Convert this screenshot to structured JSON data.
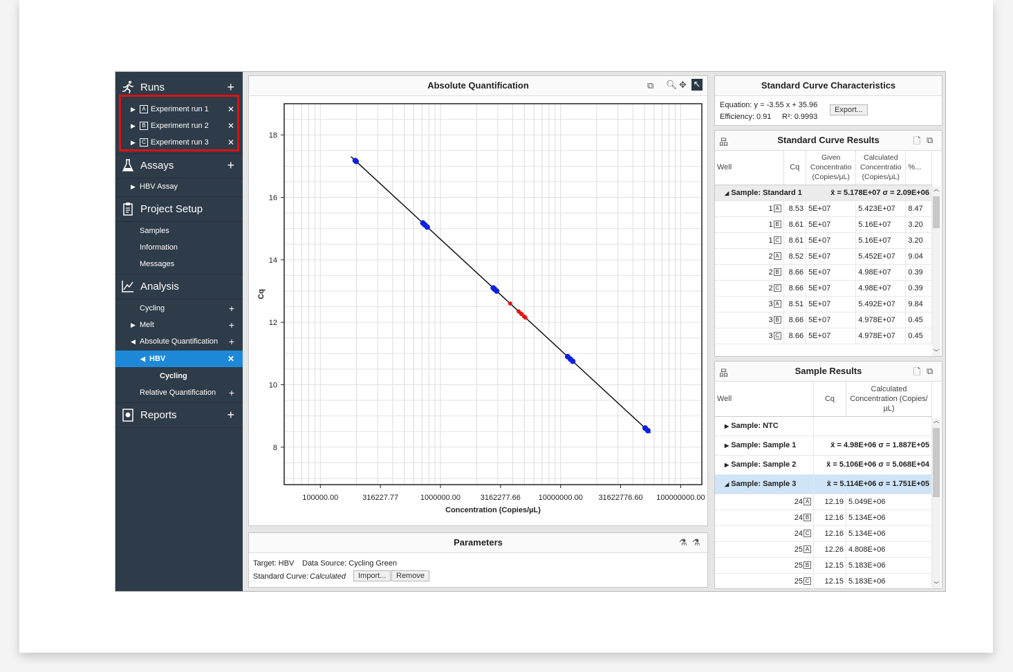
{
  "sidebar": {
    "runs": {
      "label": "Runs",
      "items": [
        {
          "letter": "A",
          "label": "Experiment run 1"
        },
        {
          "letter": "B",
          "label": "Experiment run 2"
        },
        {
          "letter": "C",
          "label": "Experiment run 3"
        }
      ]
    },
    "assays": {
      "label": "Assays",
      "items": [
        {
          "label": "HBV Assay"
        }
      ]
    },
    "project": {
      "label": "Project Setup",
      "items": [
        {
          "label": "Samples"
        },
        {
          "label": "Information"
        },
        {
          "label": "Messages"
        }
      ]
    },
    "analysis": {
      "label": "Analysis",
      "items": [
        {
          "label": "Cycling"
        },
        {
          "label": "Melt"
        },
        {
          "label": "Absolute Quantification"
        },
        {
          "label": "HBV"
        },
        {
          "label": "Cycling"
        },
        {
          "label": "Relative Quantification"
        }
      ]
    },
    "reports": {
      "label": "Reports"
    }
  },
  "chart_panel": {
    "title": "Absolute Quantification"
  },
  "chart_data": {
    "type": "scatter",
    "xlabel": "Concentration (Copies/µL)",
    "ylabel": "Cq",
    "x_scale": "log",
    "xlim": [
      50000,
      150000000
    ],
    "ylim": [
      6.8,
      19
    ],
    "x_ticks": [
      100000,
      316227.77,
      1000000,
      3162277.66,
      10000000,
      31622776.6,
      100000000
    ],
    "x_tick_labels": [
      "100000.00",
      "316227.77",
      "1000000.00",
      "3162277.66",
      "10000000.00",
      "31622776.60",
      "100000000.00"
    ],
    "y_ticks": [
      8,
      10,
      12,
      14,
      16,
      18
    ],
    "y_tick_labels": [
      "8",
      "10",
      "12",
      "14",
      "16",
      "18"
    ],
    "fit_line": {
      "slope": -3.55,
      "intercept": 35.96,
      "x_range": [
        180000,
        56000000
      ]
    },
    "series": [
      {
        "color": "#1020e0",
        "points": [
          {
            "x": 50000000,
            "y": 8.53
          },
          {
            "x": 50000000,
            "y": 8.61
          },
          {
            "x": 50000000,
            "y": 8.61
          },
          {
            "x": 5000000,
            "y": 10.75
          },
          {
            "x": 5000000,
            "y": 10.82
          },
          {
            "x": 5000000,
            "y": 10.9
          },
          {
            "x": 500000,
            "y": 13.0
          },
          {
            "x": 500000,
            "y": 13.06
          },
          {
            "x": 500000,
            "y": 13.1
          },
          {
            "x": 50000,
            "y": 15.05
          },
          {
            "x": 50000,
            "y": 15.12
          },
          {
            "x": 50000,
            "y": 15.18
          },
          {
            "x": 5000,
            "y": 17.15
          },
          {
            "x": 5000,
            "y": 17.18
          }
        ]
      },
      {
        "color": "#e01818",
        "points": [
          {
            "x": 4980000,
            "y": 12.6
          },
          {
            "x": 5106000,
            "y": 12.35
          },
          {
            "x": 5114000,
            "y": 12.28
          },
          {
            "x": 5049000,
            "y": 12.19
          },
          {
            "x": 5134000,
            "y": 12.16
          },
          {
            "x": 4808000,
            "y": 12.26
          },
          {
            "x": 5183000,
            "y": 12.15
          }
        ]
      }
    ]
  },
  "params": {
    "title": "Parameters",
    "target": "Target: HBV",
    "source": "Data Source: Cycling Green",
    "curve_label": "Standard Curve:",
    "curve_value": "Calculated",
    "import": "Import...",
    "remove": "Remove"
  },
  "chars": {
    "title": "Standard Curve Characteristics",
    "equation": "Equation: y = -3.55 x + 35.96",
    "efficiency": "Efficiency: 0.91",
    "r2": "R²: 0.9993",
    "export": "Export..."
  },
  "scr": {
    "title": "Standard Curve Results",
    "headers": [
      "Well",
      "Cq",
      "Given Concentratio (Copies/µL)",
      "Calculated Concentratio (Copies/µL)",
      "%..."
    ],
    "group": {
      "label": "Sample: Standard 1",
      "stats": "x̄ = 5.178E+07 σ = 2.09E+06"
    },
    "rows": [
      {
        "well": "1",
        "l": "A",
        "cq": "8.53",
        "given": "5E+07",
        "calc": "5.423E+07",
        "pct": "8.47"
      },
      {
        "well": "1",
        "l": "B",
        "cq": "8.61",
        "given": "5E+07",
        "calc": "5.16E+07",
        "pct": "3.20"
      },
      {
        "well": "1",
        "l": "C",
        "cq": "8.61",
        "given": "5E+07",
        "calc": "5.16E+07",
        "pct": "3.20"
      },
      {
        "well": "2",
        "l": "A",
        "cq": "8.52",
        "given": "5E+07",
        "calc": "5.452E+07",
        "pct": "9.04"
      },
      {
        "well": "2",
        "l": "B",
        "cq": "8.66",
        "given": "5E+07",
        "calc": "4.98E+07",
        "pct": "0.39"
      },
      {
        "well": "2",
        "l": "C",
        "cq": "8.66",
        "given": "5E+07",
        "calc": "4.98E+07",
        "pct": "0.39"
      },
      {
        "well": "3",
        "l": "A",
        "cq": "8.51",
        "given": "5E+07",
        "calc": "5.492E+07",
        "pct": "9.84"
      },
      {
        "well": "3",
        "l": "B",
        "cq": "8.66",
        "given": "5E+07",
        "calc": "4.978E+07",
        "pct": "0.45"
      },
      {
        "well": "3",
        "l": "C",
        "cq": "8.66",
        "given": "5E+07",
        "calc": "4.978E+07",
        "pct": "0.45"
      }
    ]
  },
  "sr": {
    "title": "Sample Results",
    "headers": [
      "Well",
      "Cq",
      "Calculated Concentration (Copies/µL)"
    ],
    "groups": [
      {
        "label": "Sample: NTC",
        "stats": ""
      },
      {
        "label": "Sample: Sample 1",
        "stats": "x̄ = 4.98E+06 σ = 1.887E+05"
      },
      {
        "label": "Sample: Sample 2",
        "stats": "x̄ = 5.106E+06 σ = 5.068E+04"
      },
      {
        "label": "Sample: Sample 3",
        "stats": "x̄ = 5.114E+06 σ = 1.751E+05"
      }
    ],
    "rows": [
      {
        "well": "24",
        "l": "A",
        "cq": "12.19",
        "calc": "5.049E+06"
      },
      {
        "well": "24",
        "l": "B",
        "cq": "12.16",
        "calc": "5.134E+06"
      },
      {
        "well": "24",
        "l": "C",
        "cq": "12.16",
        "calc": "5.134E+06"
      },
      {
        "well": "25",
        "l": "A",
        "cq": "12.26",
        "calc": "4.808E+06"
      },
      {
        "well": "25",
        "l": "B",
        "cq": "12.15",
        "calc": "5.183E+06"
      },
      {
        "well": "25",
        "l": "C",
        "cq": "12.15",
        "calc": "5.183E+06"
      }
    ]
  }
}
